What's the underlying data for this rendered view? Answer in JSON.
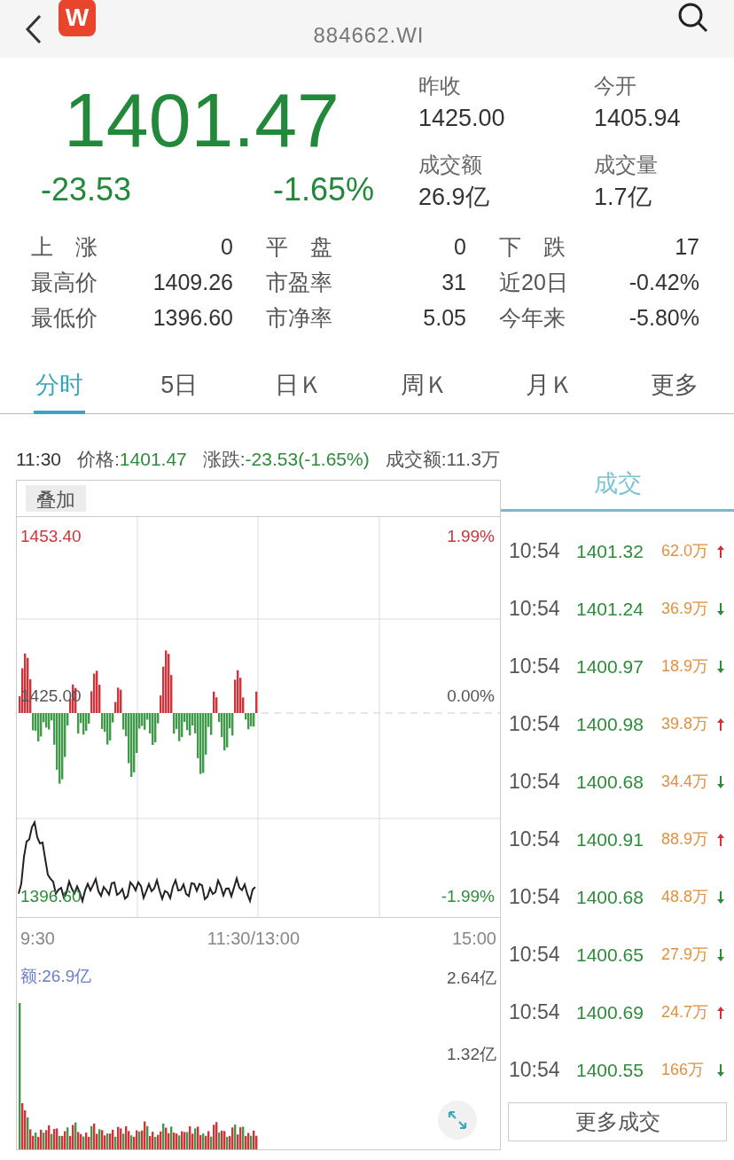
{
  "header": {
    "logo_letter": "W",
    "code": "884662.WI"
  },
  "quote": {
    "price": "1401.47",
    "change": "-23.53",
    "change_pct": "-1.65%",
    "fields": [
      {
        "label": "昨收",
        "value": "1425.00"
      },
      {
        "label": "今开",
        "value": "1405.94"
      },
      {
        "label": "成交额",
        "value": "26.9亿"
      },
      {
        "label": "成交量",
        "value": "1.7亿"
      }
    ]
  },
  "stats": [
    [
      {
        "label": "上　涨",
        "value": "0"
      },
      {
        "label": "平　盘",
        "value": "0"
      },
      {
        "label": "下　跌",
        "value": "17"
      }
    ],
    [
      {
        "label": "最高价",
        "value": "1409.26"
      },
      {
        "label": "市盈率",
        "value": "31"
      },
      {
        "label": "近20日",
        "value": "-0.42%"
      }
    ],
    [
      {
        "label": "最低价",
        "value": "1396.60"
      },
      {
        "label": "市净率",
        "value": "5.05"
      },
      {
        "label": "今年来",
        "value": "-5.80%"
      }
    ]
  ],
  "tabs": [
    {
      "label": "分时",
      "selected": true
    },
    {
      "label": "5日",
      "selected": false
    },
    {
      "label": "日Ｋ",
      "selected": false
    },
    {
      "label": "周Ｋ",
      "selected": false
    },
    {
      "label": "月Ｋ",
      "selected": false
    },
    {
      "label": "更多",
      "selected": false
    }
  ],
  "info_line": {
    "time": "11:30",
    "price_label": "价格:",
    "price": "1401.47",
    "change_label": "涨跌:",
    "change": "-23.53(-1.65%)",
    "amount_label": "成交额:",
    "amount": "11.3万"
  },
  "chart": {
    "overlay_button": "叠加",
    "labels": [
      {
        "text": "1453.40",
        "color": "#d0333a"
      },
      {
        "text": "1.99%",
        "color": "#d0333a"
      },
      {
        "text": "1425.00",
        "color": "#555555"
      },
      {
        "text": "0.00%",
        "color": "#555555"
      },
      {
        "text": "1396.60",
        "color": "#2e8b3a"
      },
      {
        "text": "-1.99%",
        "color": "#2e8b3a"
      }
    ],
    "time_axis": [
      "9:30",
      "11:30/13:00",
      "15:00"
    ],
    "volume_label": "额:26.9亿",
    "volume_ticks": [
      "2.64亿",
      "1.32亿"
    ]
  },
  "trades": {
    "title": "成交",
    "rows": [
      {
        "time": "10:54",
        "price": "1401.32",
        "volume": "62.0万",
        "kind": "up"
      },
      {
        "time": "10:54",
        "price": "1401.24",
        "volume": "36.9万",
        "kind": "down"
      },
      {
        "time": "10:54",
        "price": "1400.97",
        "volume": "18.9万",
        "kind": "down"
      },
      {
        "time": "10:54",
        "price": "1400.98",
        "volume": "39.8万",
        "kind": "up"
      },
      {
        "time": "10:54",
        "price": "1400.68",
        "volume": "34.4万",
        "kind": "down"
      },
      {
        "time": "10:54",
        "price": "1400.91",
        "volume": "88.9万",
        "kind": "up"
      },
      {
        "time": "10:54",
        "price": "1400.68",
        "volume": "48.8万",
        "kind": "down"
      },
      {
        "time": "10:54",
        "price": "1400.65",
        "volume": "27.9万",
        "kind": "down"
      },
      {
        "time": "10:54",
        "price": "1400.69",
        "volume": "24.7万",
        "kind": "up"
      },
      {
        "time": "10:54",
        "price": "1400.55",
        "volume": "166万",
        "kind": "down"
      }
    ],
    "more_button": "更多成交"
  }
}
